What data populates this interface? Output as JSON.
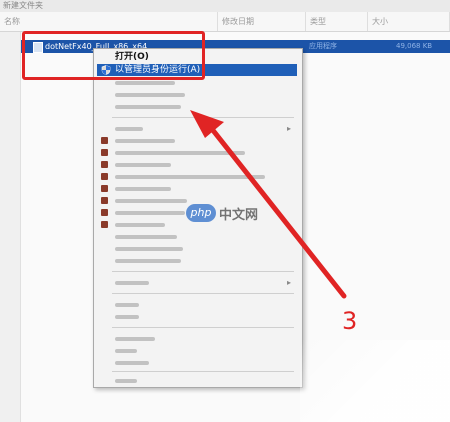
{
  "explorer": {
    "title_bar": "新建文件夹",
    "columns": [
      "名称",
      "修改日期",
      "类型",
      "大小"
    ],
    "selected_file": {
      "name": "dotNetFx40_Full_x86_x64",
      "type": "应用程序",
      "size": "49,068 KB"
    }
  },
  "context_menu": {
    "open": "打开(O)",
    "run_as_admin": "以管理员身份运行(A)"
  },
  "annotation": {
    "step_number": "3",
    "color": "#e02424"
  },
  "watermark": {
    "logo": "php",
    "text": "中文网"
  }
}
